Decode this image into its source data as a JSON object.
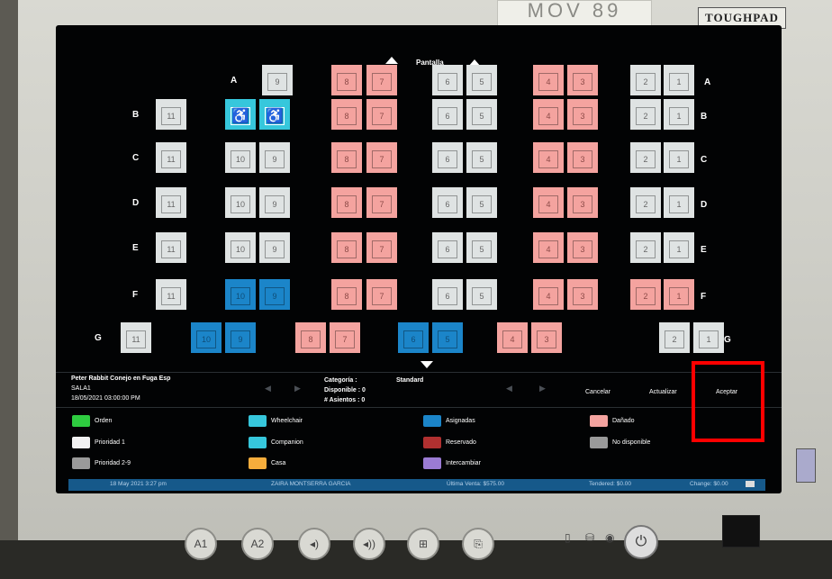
{
  "device": {
    "brand": "TOUGHPAD",
    "sticker": "MOV 89",
    "buttons": [
      "A1",
      "A2"
    ]
  },
  "screen_label": "Pantalla",
  "rows": [
    {
      "letter": "A",
      "seats": [
        [
          "9",
          "w"
        ],
        [
          "8",
          "p"
        ],
        [
          "7",
          "p"
        ],
        [
          "6",
          "w"
        ],
        [
          "5",
          "w"
        ],
        [
          "4",
          "p"
        ],
        [
          "3",
          "p"
        ],
        [
          "2",
          "w"
        ],
        [
          "1",
          "w"
        ]
      ]
    },
    {
      "letter": "B",
      "seats": [
        [
          "11",
          "w"
        ],
        [
          "♿",
          "c"
        ],
        [
          "♿",
          "c"
        ],
        [
          "8",
          "p"
        ],
        [
          "7",
          "p"
        ],
        [
          "6",
          "w"
        ],
        [
          "5",
          "w"
        ],
        [
          "4",
          "p"
        ],
        [
          "3",
          "p"
        ],
        [
          "2",
          "w"
        ],
        [
          "1",
          "w"
        ]
      ]
    },
    {
      "letter": "C",
      "seats": [
        [
          "11",
          "w"
        ],
        [
          "10",
          "w"
        ],
        [
          "9",
          "w"
        ],
        [
          "8",
          "p"
        ],
        [
          "7",
          "p"
        ],
        [
          "6",
          "w"
        ],
        [
          "5",
          "w"
        ],
        [
          "4",
          "p"
        ],
        [
          "3",
          "p"
        ],
        [
          "2",
          "w"
        ],
        [
          "1",
          "w"
        ]
      ]
    },
    {
      "letter": "D",
      "seats": [
        [
          "11",
          "w"
        ],
        [
          "10",
          "w"
        ],
        [
          "9",
          "w"
        ],
        [
          "8",
          "p"
        ],
        [
          "7",
          "p"
        ],
        [
          "6",
          "w"
        ],
        [
          "5",
          "w"
        ],
        [
          "4",
          "p"
        ],
        [
          "3",
          "p"
        ],
        [
          "2",
          "w"
        ],
        [
          "1",
          "w"
        ]
      ]
    },
    {
      "letter": "E",
      "seats": [
        [
          "11",
          "w"
        ],
        [
          "10",
          "w"
        ],
        [
          "9",
          "w"
        ],
        [
          "8",
          "p"
        ],
        [
          "7",
          "p"
        ],
        [
          "6",
          "w"
        ],
        [
          "5",
          "w"
        ],
        [
          "4",
          "p"
        ],
        [
          "3",
          "p"
        ],
        [
          "2",
          "w"
        ],
        [
          "1",
          "w"
        ]
      ]
    },
    {
      "letter": "F",
      "seats": [
        [
          "11",
          "w"
        ],
        [
          "10",
          "b"
        ],
        [
          "9",
          "b"
        ],
        [
          "8",
          "p"
        ],
        [
          "7",
          "p"
        ],
        [
          "6",
          "w"
        ],
        [
          "5",
          "w"
        ],
        [
          "4",
          "p"
        ],
        [
          "3",
          "p"
        ],
        [
          "2",
          "p"
        ],
        [
          "1",
          "p"
        ]
      ]
    },
    {
      "letter": "G",
      "seats": [
        [
          "11",
          "w"
        ],
        [
          "10",
          "b"
        ],
        [
          "9",
          "b"
        ],
        [
          "8",
          "p"
        ],
        [
          "7",
          "p"
        ],
        [
          "6",
          "b"
        ],
        [
          "5",
          "b"
        ],
        [
          "4",
          "p"
        ],
        [
          "3",
          "p"
        ],
        [
          "2",
          "w"
        ],
        [
          "1",
          "w"
        ]
      ]
    }
  ],
  "info": {
    "movie": "Peter Rabbit Conejo en Fuga Esp",
    "sala": "SALA1",
    "datetime": "18/05/2021 03:00:00 PM",
    "categoria_label": "Categoría :",
    "categoria_value": "Standard",
    "disponible": "Disponible : 0",
    "asientos": "# Asientos : 0"
  },
  "actions": {
    "cancel": "Cancelar",
    "update": "Actualizar",
    "accept": "Aceptar"
  },
  "legend": [
    {
      "label": "Orden",
      "color": "#2ecc40"
    },
    {
      "label": "Wheelchair",
      "color": "#36c7dc"
    },
    {
      "label": "Asignadas",
      "color": "#1b85c9"
    },
    {
      "label": "Dañado",
      "color": "#f4a39f"
    },
    {
      "label": "Prioridad 1",
      "color": "#f2f2f2"
    },
    {
      "label": "Companion",
      "color": "#36c7dc"
    },
    {
      "label": "Reservado",
      "color": "#b03030"
    },
    {
      "label": "No disponible",
      "color": "#9a9a9a"
    },
    {
      "label": "Prioridad 2-9",
      "color": "#9a9a9a"
    },
    {
      "label": "Casa",
      "color": "#f6ad3c"
    },
    {
      "label": "Intercambiar",
      "color": "#9b7bd4"
    }
  ],
  "status": {
    "date": "18 May 2021 3:27 pm",
    "user": "ZAIRA MONTSERRA GARCIA",
    "last_sale": "Última Venta: $575.00",
    "tendered": "Tendered: $0.00",
    "change": "Change: $0.00"
  }
}
